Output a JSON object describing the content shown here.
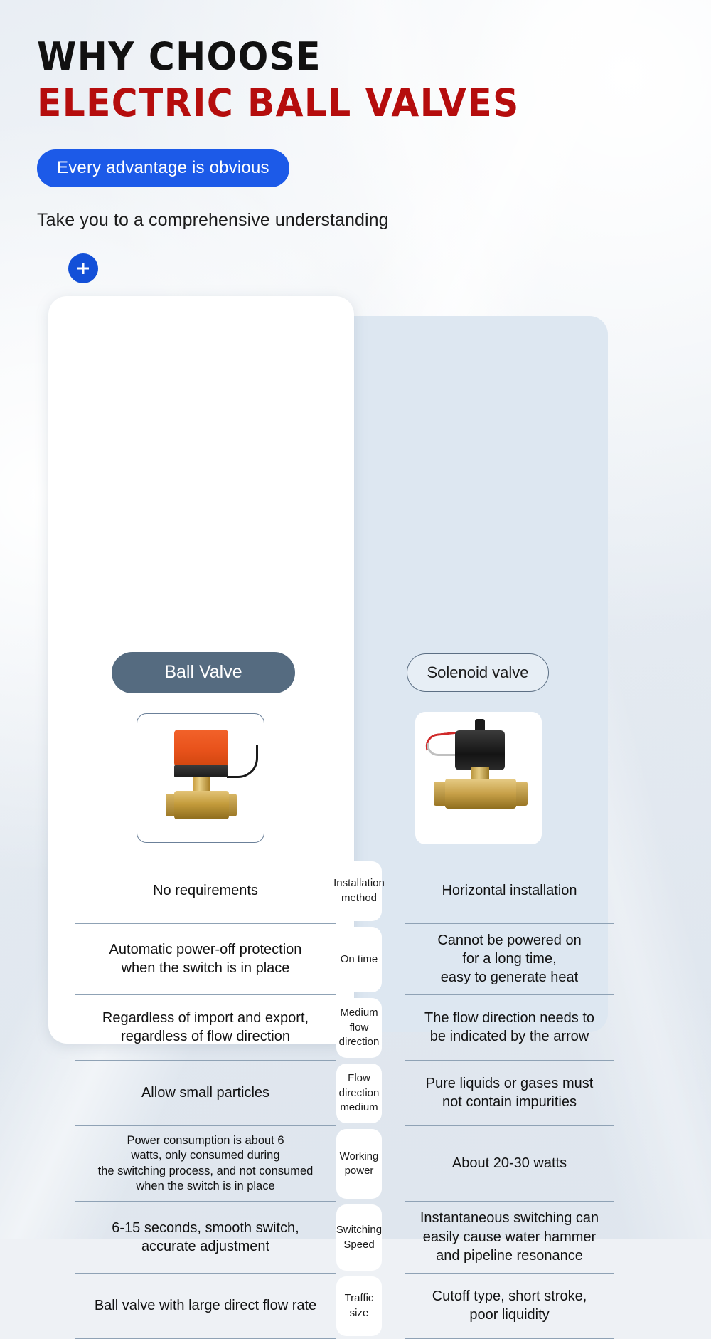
{
  "header": {
    "title_line1": "WHY CHOOSE",
    "title_line2": "ELECTRIC BALL VALVES",
    "tag": "Every advantage is obvious",
    "subtitle": "Take you to a comprehensive understanding",
    "plus_icon": "plus-icon",
    "colors": {
      "title1": "#111111",
      "title2": "#b50d0d",
      "tag_bg": "#1c5ae8",
      "plus_bg": "#1350d8"
    }
  },
  "comparison": {
    "left_header": "Ball Valve",
    "right_header": "Solenoid valve",
    "left_image_alt": "electric ball valve with orange actuator",
    "right_image_alt": "brass solenoid valve with black coil",
    "rows": [
      {
        "label": "Installation\nmethod",
        "label_lines": [
          "Installation",
          "method"
        ],
        "left": "No requirements",
        "left_lines": [
          "No requirements"
        ],
        "right": "Horizontal installation",
        "right_lines": [
          "Horizontal installation"
        ]
      },
      {
        "label": "On time",
        "label_lines": [
          "On time"
        ],
        "left": "Automatic power-off protection when the switch is in place",
        "left_lines": [
          "Automatic power-off protection",
          "when the switch is in place"
        ],
        "right": "Cannot be powered on for a long time, easy to generate heat",
        "right_lines": [
          "Cannot be powered on",
          "for a long time,",
          "easy to generate heat"
        ]
      },
      {
        "label": "Medium flow direction",
        "label_lines": [
          "Medium",
          "flow",
          "direction"
        ],
        "left": "Regardless of import and export, regardless of flow direction",
        "left_lines": [
          "Regardless of import and export,",
          "regardless of flow direction"
        ],
        "right": "The flow direction needs to be indicated by the arrow",
        "right_lines": [
          "The flow direction needs to",
          "be indicated by the arrow"
        ]
      },
      {
        "label": "Flow direction medium",
        "label_lines": [
          "Flow",
          "direction",
          "medium"
        ],
        "left": "Allow small particles",
        "left_lines": [
          "Allow small particles"
        ],
        "right": "Pure liquids or gases must not contain impurities",
        "right_lines": [
          "Pure liquids or gases must",
          "not contain impurities"
        ]
      },
      {
        "label": "Working power",
        "label_lines": [
          "Working",
          "power"
        ],
        "left": "Power consumption is about 6 watts, only consumed during the switching process, and not consumed when the switch is in place",
        "left_lines": [
          "Power consumption is about 6",
          "watts, only consumed during",
          "the switching process, and not consumed",
          "when the switch is in place"
        ],
        "left_small": true,
        "right": "About 20-30 watts",
        "right_lines": [
          "About 20-30 watts"
        ]
      },
      {
        "label": "Switching Speed",
        "label_lines": [
          "Switching",
          "Speed"
        ],
        "left": "6-15 seconds, smooth switch, accurate adjustment",
        "left_lines": [
          "6-15 seconds, smooth switch,",
          "accurate adjustment"
        ],
        "right": "Instantaneous switching can easily cause water hammer and pipeline resonance",
        "right_lines": [
          "Instantaneous switching can",
          "easily cause water hammer",
          "and pipeline resonance"
        ]
      },
      {
        "label": "Traffic size",
        "label_lines": [
          "Traffic",
          "size"
        ],
        "left": "Ball valve with large direct flow rate",
        "left_lines": [
          "Ball valve with large direct flow rate"
        ],
        "right": "Cutoff type, short stroke, poor liquidity",
        "right_lines": [
          "Cutoff type, short stroke,",
          "poor liquidity"
        ]
      }
    ]
  }
}
